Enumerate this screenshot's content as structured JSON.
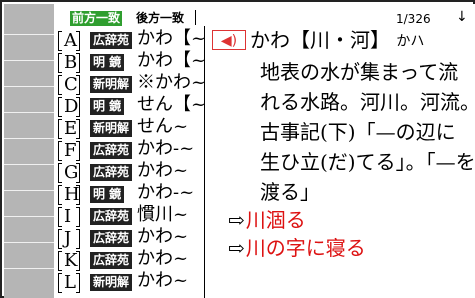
{
  "topbar": {
    "mode_active": "前方一致",
    "mode_inactive": "後方一致",
    "page": "1/326",
    "arrow": "↓"
  },
  "list": [
    {
      "letter": "A",
      "badge": "広辞苑",
      "word": "かわ【~"
    },
    {
      "letter": "B",
      "badge": "明 鏡",
      "word": "かわ【~"
    },
    {
      "letter": "C",
      "badge": "新明解",
      "word": "※かわ~"
    },
    {
      "letter": "D",
      "badge": "明 鏡",
      "word": "せん【~"
    },
    {
      "letter": "E",
      "badge": "新明解",
      "word": "せん~"
    },
    {
      "letter": "F",
      "badge": "広辞苑",
      "word": "かわ-~"
    },
    {
      "letter": "G",
      "badge": "広辞苑",
      "word": "かわ~"
    },
    {
      "letter": "H",
      "badge": "明 鏡",
      "word": "かわ-~"
    },
    {
      "letter": "I",
      "badge": "広辞苑",
      "word": "慣川~"
    },
    {
      "letter": "J",
      "badge": "広辞苑",
      "word": "かわ~"
    },
    {
      "letter": "K",
      "badge": "広辞苑",
      "word": "かわ~"
    },
    {
      "letter": "L",
      "badge": "新明解",
      "word": "かわ~"
    }
  ],
  "detail": {
    "speaker_icon": "speaker-icon",
    "headword": "かわ【川・河】",
    "headword_small": "かハ",
    "definition_lines": [
      "地表の水が集まって流",
      "れる水路。河川。河流。",
      "古事記(下)「—の辺に",
      "生ひ立(だ)てる」。「—を",
      "渡る」"
    ],
    "refs": [
      {
        "arrow": "⇨",
        "text": "川涸る"
      },
      {
        "arrow": "⇨",
        "text": "川の字に寝る"
      }
    ]
  },
  "colors": {
    "accent_green": "#2f9e2f",
    "ref_red": "#d11",
    "speaker_red": "#d33",
    "sidebar_gray": "#b5b5b5"
  }
}
